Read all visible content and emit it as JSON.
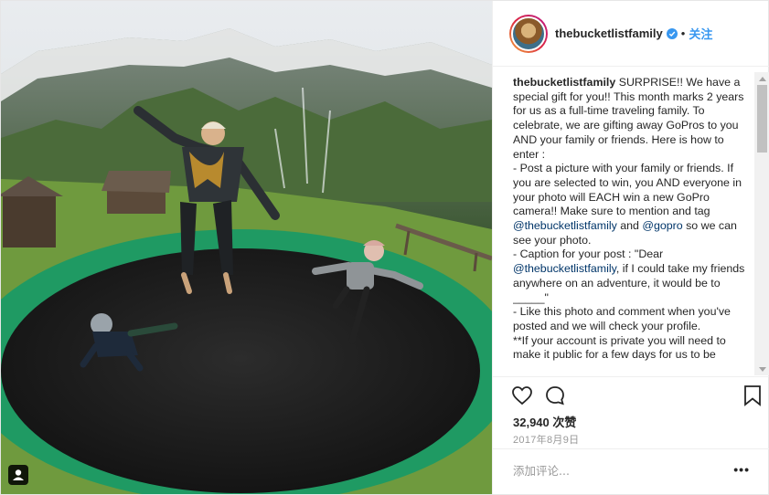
{
  "post": {
    "username": "thebucketlistfamily",
    "verified": true,
    "dot": "•",
    "follow_label": "关注",
    "caption": {
      "username": "thebucketlistfamily",
      "segments": [
        {
          "type": "text",
          "text": " SURPRISE!! We have a special gift for you!! This month marks 2 years for us as a full-time traveling family. To celebrate, we are gifting away GoPros to you AND your family or friends. Here is how to enter :"
        },
        {
          "type": "break"
        },
        {
          "type": "text",
          "text": "- Post a picture with your family or friends. If you are selected to win, you AND everyone in your photo will EACH win a new GoPro camera!! Make sure to mention and tag "
        },
        {
          "type": "mention",
          "text": "@thebucketlistfamily"
        },
        {
          "type": "text",
          "text": " and "
        },
        {
          "type": "mention",
          "text": "@gopro"
        },
        {
          "type": "text",
          "text": " so we can see your photo."
        },
        {
          "type": "break"
        },
        {
          "type": "text",
          "text": "- Caption for your post : \"Dear "
        },
        {
          "type": "mention",
          "text": "@thebucketlistfamily"
        },
        {
          "type": "text",
          "text": ", if I could take my friends anywhere on an adventure, it would be to _____\""
        },
        {
          "type": "break"
        },
        {
          "type": "text",
          "text": "- Like this photo and comment when you've posted and we will check your profile."
        },
        {
          "type": "break"
        },
        {
          "type": "text",
          "text": "**If your account is private you will need to make it public for a few days for us to be"
        }
      ]
    },
    "likes": "32,940 次赞",
    "date": "2017年8月9日",
    "comment_placeholder": "添加评论...",
    "more_label": "•••"
  },
  "icons": {
    "like": "heart-icon",
    "comment": "comment-bubble-icon",
    "save": "bookmark-icon",
    "user_tag": "user-tag-icon",
    "verified": "verified-badge-icon"
  },
  "colors": {
    "link": "#3897f0",
    "mention": "#003569",
    "secondary_text": "#999999",
    "trampoline_pad": "#1f9a63"
  }
}
